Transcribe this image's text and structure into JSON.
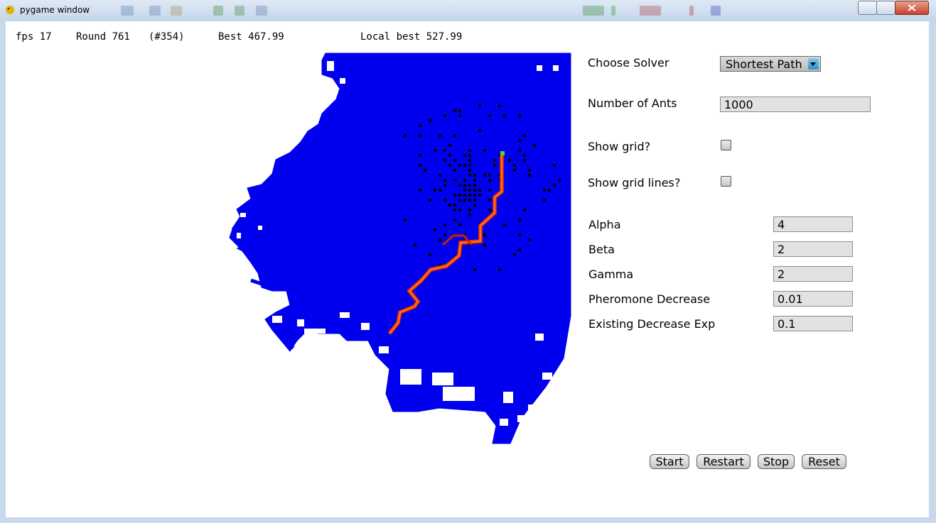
{
  "window": {
    "title": "pygame window"
  },
  "status": {
    "fps": "fps 17",
    "round": "Round 761",
    "round_index": "(#354)",
    "best": "Best 467.99",
    "local_best": "Local best 527.99"
  },
  "controls": {
    "solver_label": "Choose Solver",
    "solver_value": "Shortest Path",
    "ants_label": "Number of Ants",
    "ants_value": "1000",
    "show_grid_label": "Show grid?",
    "show_grid_checked": false,
    "show_grid_lines_label": "Show grid lines?",
    "show_grid_lines_checked": false,
    "params": [
      {
        "label": "Alpha",
        "value": "4"
      },
      {
        "label": "Beta",
        "value": "2"
      },
      {
        "label": "Gamma",
        "value": "2"
      },
      {
        "label": "Pheromone Decrease",
        "value": "0.01"
      },
      {
        "label": "Existing Decrease Exp",
        "value": "0.1"
      }
    ]
  },
  "buttons": {
    "start": "Start",
    "restart": "Restart",
    "stop": "Stop",
    "reset": "Reset"
  },
  "colors": {
    "explored": "#0000ee",
    "path_outer": "#cc2200",
    "path_inner": "#ff6a20",
    "ants": "#000000",
    "goal": "#44dd22",
    "background": "#ffffff"
  }
}
